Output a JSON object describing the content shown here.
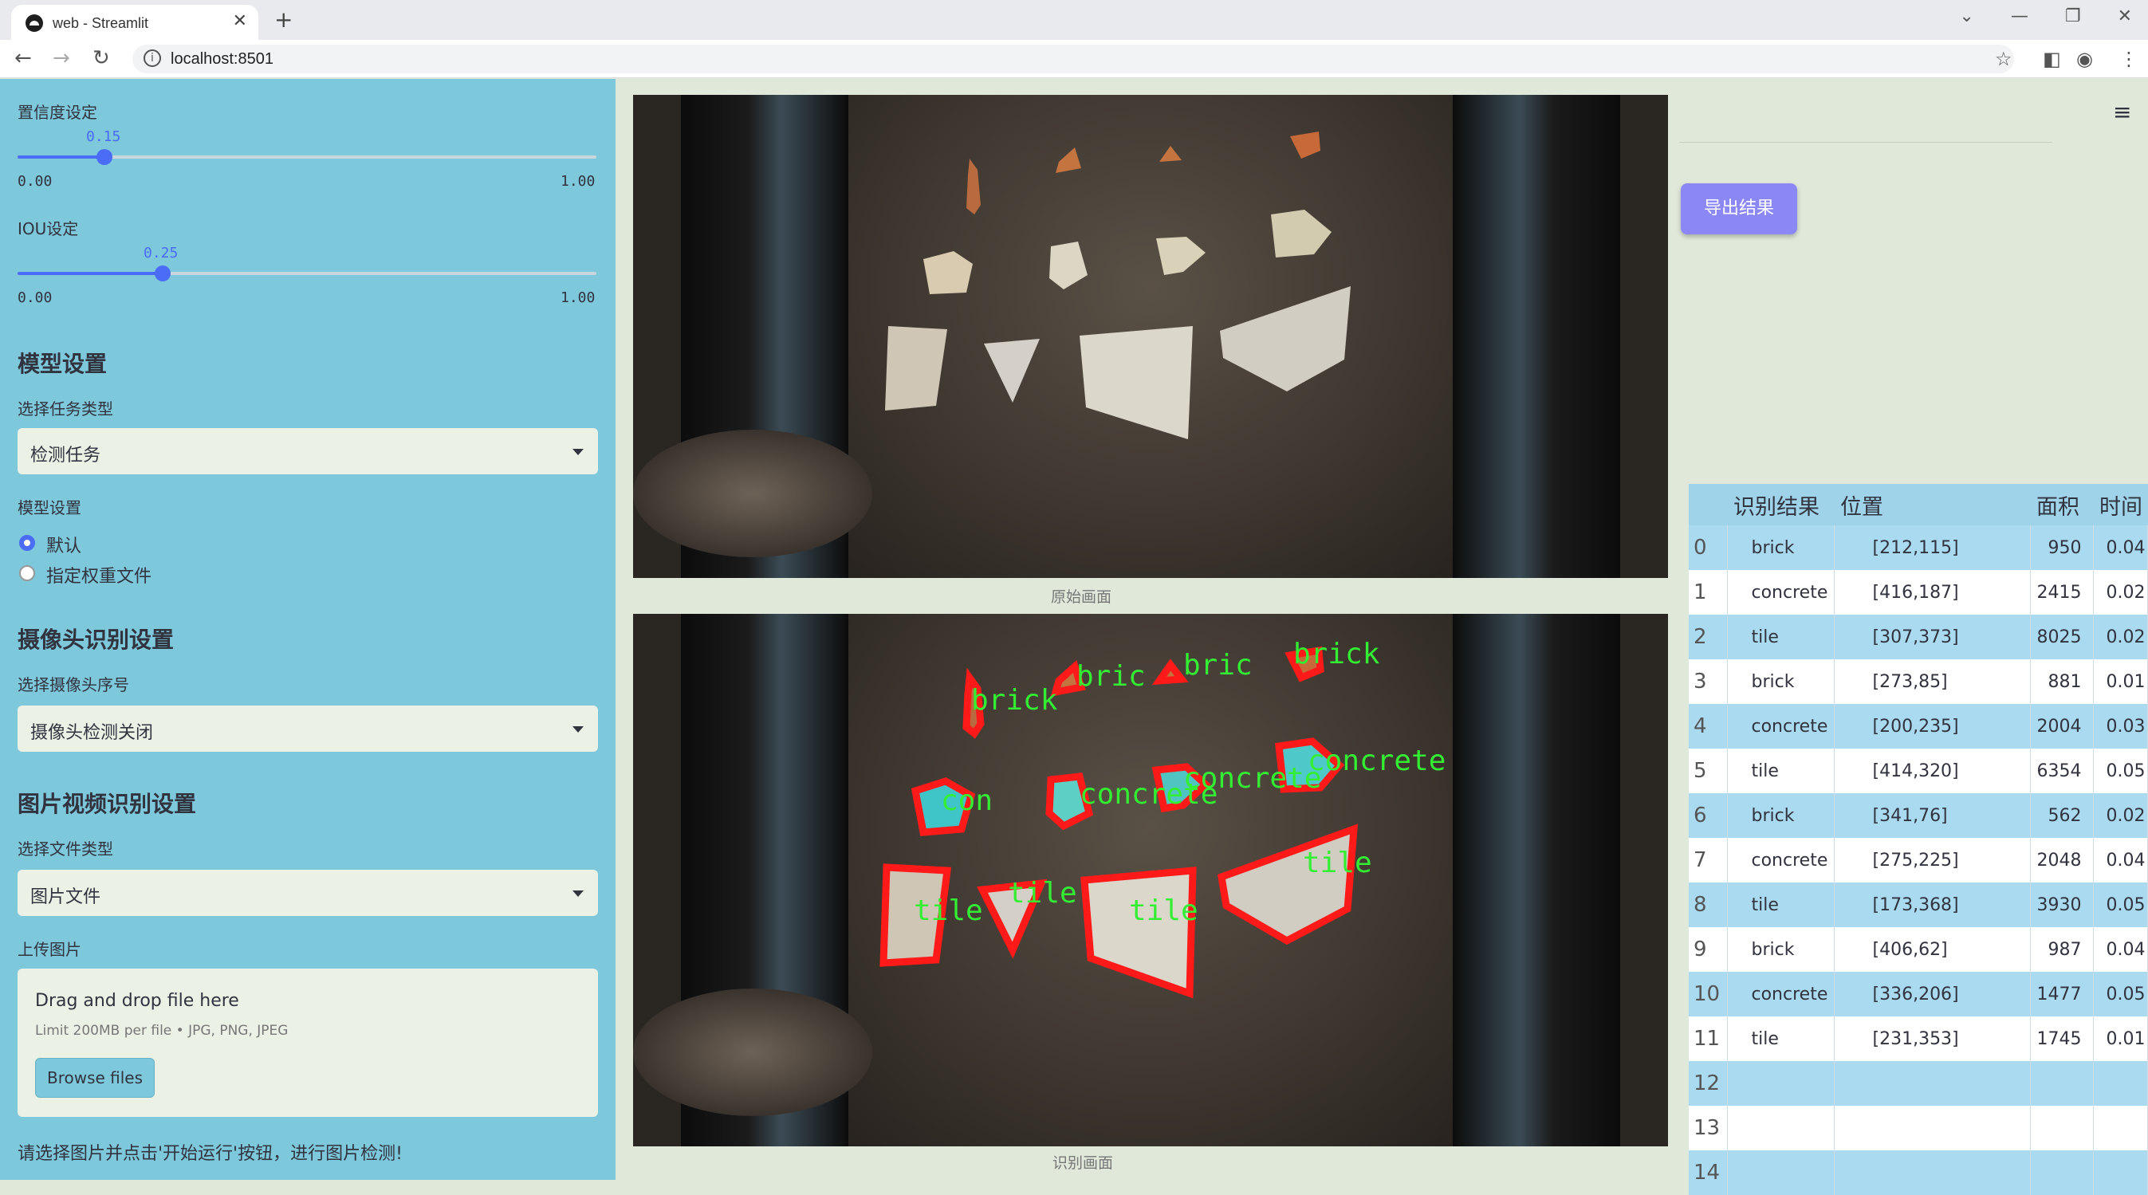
{
  "browser": {
    "tab_title": "web - Streamlit",
    "url": "localhost:8501"
  },
  "sidebar": {
    "conf_label": "置信度设定",
    "conf_value": "0.15",
    "conf_min": "0.00",
    "conf_max": "1.00",
    "conf_level": 0.15,
    "iou_label": "IOU设定",
    "iou_value": "0.25",
    "iou_min": "0.00",
    "iou_max": "1.00",
    "iou_level": 0.25,
    "model_header": "模型设置",
    "task_label": "选择任务类型",
    "task_value": "检测任务",
    "model_label": "模型设置",
    "radio_default": "默认",
    "radio_custom": "指定权重文件",
    "camera_header": "摄像头识别设置",
    "camera_label": "选择摄像头序号",
    "camera_value": "摄像头检测关闭",
    "media_header": "图片视频识别设置",
    "filetype_label": "选择文件类型",
    "filetype_value": "图片文件",
    "upload_label": "上传图片",
    "upload_title": "Drag and drop file here",
    "upload_limit": "Limit 200MB per file • JPG, PNG, JPEG",
    "browse_label": "Browse files",
    "hint": "请选择图片并点击'开始运行'按钮，进行图片检测!"
  },
  "main": {
    "original_caption": "原始画面",
    "result_caption": "识别画面",
    "export_label": "导出结果"
  },
  "table": {
    "headers": [
      "",
      "识别结果",
      "位置",
      "面积",
      "时间"
    ],
    "rows": [
      {
        "idx": "0",
        "cls": "brick",
        "pos": "[212,115]",
        "area": "950",
        "time": "0.04"
      },
      {
        "idx": "1",
        "cls": "concrete",
        "pos": "[416,187]",
        "area": "2415",
        "time": "0.02"
      },
      {
        "idx": "2",
        "cls": "tile",
        "pos": "[307,373]",
        "area": "8025",
        "time": "0.02"
      },
      {
        "idx": "3",
        "cls": "brick",
        "pos": "[273,85]",
        "area": "881",
        "time": "0.01"
      },
      {
        "idx": "4",
        "cls": "concrete",
        "pos": "[200,235]",
        "area": "2004",
        "time": "0.03"
      },
      {
        "idx": "5",
        "cls": "tile",
        "pos": "[414,320]",
        "area": "6354",
        "time": "0.05"
      },
      {
        "idx": "6",
        "cls": "brick",
        "pos": "[341,76]",
        "area": "562",
        "time": "0.02"
      },
      {
        "idx": "7",
        "cls": "concrete",
        "pos": "[275,225]",
        "area": "2048",
        "time": "0.04"
      },
      {
        "idx": "8",
        "cls": "tile",
        "pos": "[173,368]",
        "area": "3930",
        "time": "0.05"
      },
      {
        "idx": "9",
        "cls": "brick",
        "pos": "[406,62]",
        "area": "987",
        "time": "0.04"
      },
      {
        "idx": "10",
        "cls": "concrete",
        "pos": "[336,206]",
        "area": "1477",
        "time": "0.05"
      },
      {
        "idx": "11",
        "cls": "tile",
        "pos": "[231,353]",
        "area": "1745",
        "time": "0.01"
      },
      {
        "idx": "12",
        "cls": "",
        "pos": "",
        "area": "",
        "time": ""
      },
      {
        "idx": "13",
        "cls": "",
        "pos": "",
        "area": "",
        "time": ""
      },
      {
        "idx": "14",
        "cls": "",
        "pos": "",
        "area": "",
        "time": ""
      }
    ]
  },
  "detections": [
    {
      "label": "brick"
    },
    {
      "label": "bric"
    },
    {
      "label": "bric"
    },
    {
      "label": "brick"
    },
    {
      "label": "con"
    },
    {
      "label": "concrete"
    },
    {
      "label": "concrete"
    },
    {
      "label": "concrete"
    },
    {
      "label": "tile"
    },
    {
      "label": "tile"
    },
    {
      "label": "tile"
    },
    {
      "label": "tile"
    }
  ],
  "colors": {
    "sidebar_bg": "#7ec8dc",
    "accent": "#4a6cf7",
    "export_button": "#8b88f6",
    "detection_outline": "#ff1a1a",
    "detection_text": "#33ee33"
  }
}
